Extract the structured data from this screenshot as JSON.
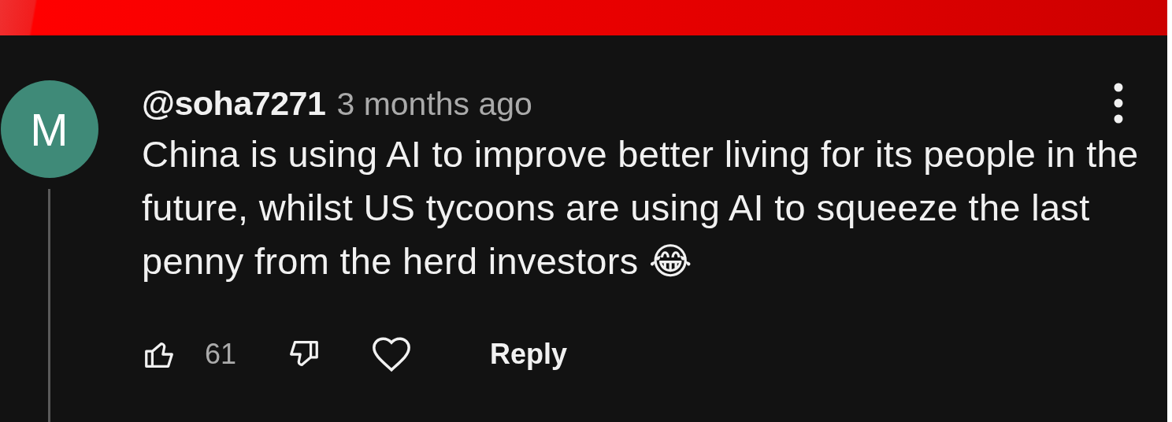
{
  "comment": {
    "avatar_letter": "M",
    "author": "@soha7271",
    "time": "3 months ago",
    "text": "China is using AI to improve better living for its people in the future, whilst US tycoons are using AI to squeeze the last penny from the herd investors 😂",
    "like_count": "61",
    "reply_label": "Reply"
  }
}
